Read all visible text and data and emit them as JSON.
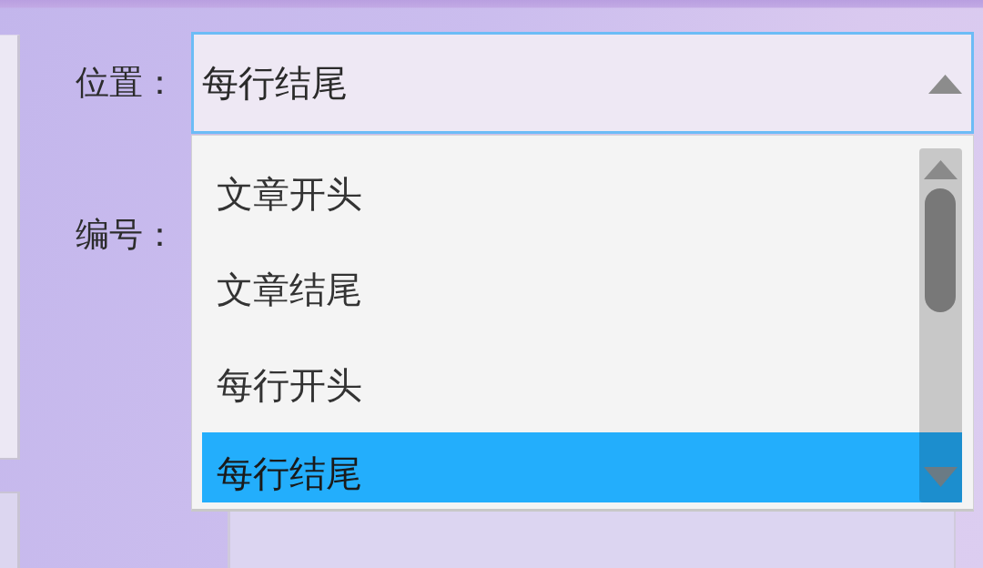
{
  "form": {
    "fields": [
      {
        "kind": "dropdown",
        "label": "位置：",
        "value": "每行结尾",
        "expanded": true,
        "options": [
          {
            "label": "文章开头",
            "selected": false
          },
          {
            "label": "文章结尾",
            "selected": false
          },
          {
            "label": "每行开头",
            "selected": false
          },
          {
            "label": "每行结尾",
            "selected": true
          }
        ]
      },
      {
        "kind": "label",
        "label": "编号："
      }
    ]
  }
}
